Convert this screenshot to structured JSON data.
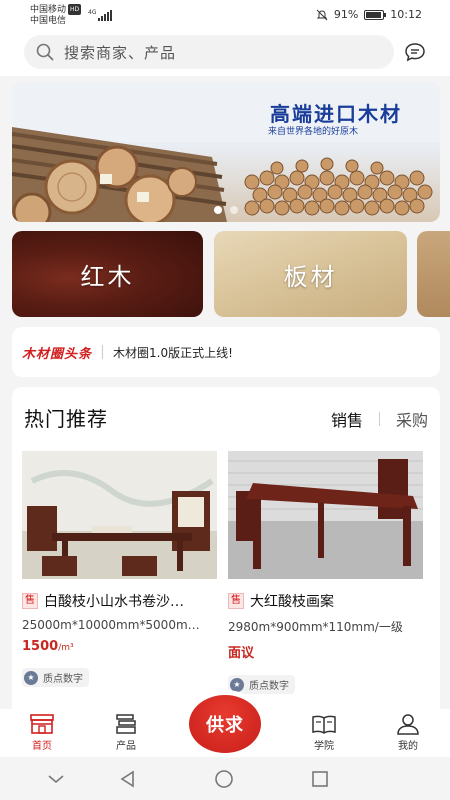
{
  "status_bar": {
    "carrier_1": "中国移动",
    "carrier_1_badge": "HD",
    "carrier_2": "中国电信",
    "network": "4G",
    "battery_text": "91%",
    "battery_level": 0.91,
    "time": "10:12"
  },
  "search": {
    "placeholder": "搜索商家、产品"
  },
  "banner": {
    "title": "高端进口木材",
    "subtitle": "来自世界各地的好原木",
    "slide_count": 2,
    "active_slide": 1
  },
  "categories": [
    {
      "label": "红木"
    },
    {
      "label": "板材"
    },
    {
      "label": ""
    }
  ],
  "news": {
    "brand": "木材圈头条",
    "headline": "木材圈1.0版正式上线!"
  },
  "hot": {
    "title": "热门推荐",
    "tabs": [
      {
        "label": "销售",
        "active": true
      },
      {
        "label": "采购",
        "active": false
      }
    ],
    "products": [
      {
        "tag": "售",
        "name": "白酸枝小山水书卷沙…",
        "spec": "25000m*10000mm*5000m…",
        "price": "1500",
        "price_unit": "/m³",
        "shop": "质点数字"
      },
      {
        "tag": "售",
        "name": "大红酸枝画案",
        "spec": "2980m*900mm*110mm/一级",
        "price": "面议",
        "price_unit": "",
        "shop": "质点数字"
      }
    ]
  },
  "tabbar": {
    "items": [
      {
        "label": "首页",
        "icon": "store-icon",
        "active": true
      },
      {
        "label": "产品",
        "icon": "layers-icon",
        "active": false
      },
      {
        "label": "学院",
        "icon": "book-icon",
        "active": false
      },
      {
        "label": "我的",
        "icon": "user-icon",
        "active": false
      }
    ],
    "center_label": "供求"
  },
  "colors": {
    "accent": "#d21f1f",
    "banner_title": "#1a3d9a",
    "price": "#c8281f"
  }
}
